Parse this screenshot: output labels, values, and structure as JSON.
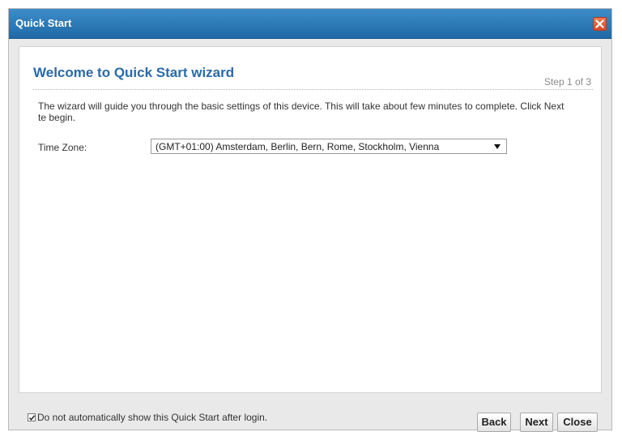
{
  "window": {
    "title": "Quick Start"
  },
  "wizard": {
    "heading": "Welcome to Quick Start wizard",
    "step": "Step 1 of 3",
    "description": "The wizard will guide you through the basic settings of this device. This will take about few minutes to complete. Click Next te begin.",
    "timezone_label": "Time Zone:",
    "timezone_value": "(GMT+01:00) Amsterdam, Berlin, Bern, Rome, Stockholm, Vienna"
  },
  "footer": {
    "checkbox_label": "Do not automatically show this Quick Start after login.",
    "checkbox_checked": true,
    "back_label": "Back",
    "next_label": "Next",
    "close_label": "Close"
  },
  "colors": {
    "titlebar": "#2a7abb",
    "heading": "#2a6aa8",
    "close_icon": "#e0502d"
  },
  "icons": {
    "close": "close-icon",
    "dropdown": "triangle-down-icon",
    "check": "checkmark-icon"
  }
}
